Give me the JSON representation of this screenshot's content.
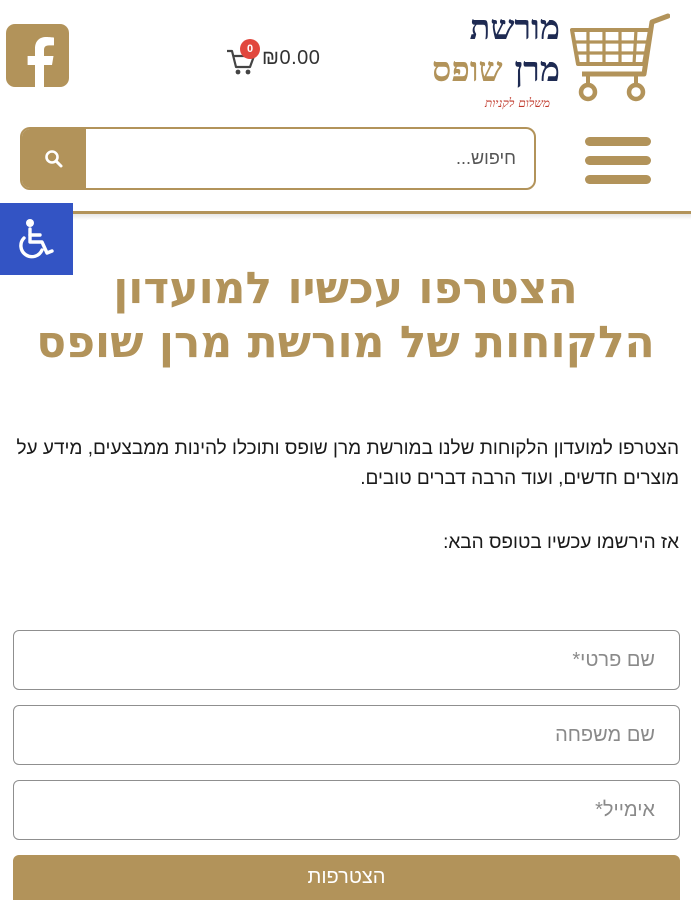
{
  "header": {
    "facebook_icon": "facebook-icon",
    "cart": {
      "count": "0",
      "amount": "₪0.00",
      "icon": "cart-icon"
    },
    "logo": {
      "line1": "מורשת",
      "line2_a": "מרן",
      "line2_b": "שופס",
      "tagline": "משלום לקניות"
    },
    "search": {
      "placeholder": "חיפוש...",
      "value": "",
      "icon": "search-icon"
    },
    "menu_icon": "hamburger-icon"
  },
  "accessibility": {
    "icon": "wheelchair-icon"
  },
  "main": {
    "headline_line1": "הצטרפו עכשיו למועדון",
    "headline_line2": "הלקוחות של מורשת מרן שופס",
    "intro": "הצטרפו למועדון הלקוחות שלנו במורשת מרן שופס ותוכלו להינות ממבצעים, מידע על מוצרים חדשים, ועוד הרבה דברים טובים.",
    "cta": "אז הירשמו עכשיו בטופס הבא:"
  },
  "form": {
    "first_name": {
      "placeholder": "שם פרטי*",
      "value": ""
    },
    "last_name": {
      "placeholder": "שם משפחה",
      "value": ""
    },
    "email": {
      "placeholder": "אימייל*",
      "value": ""
    },
    "submit_label": "הצטרפות"
  },
  "colors": {
    "gold": "#b2935a",
    "navy": "#1e2a52",
    "a11y_blue": "#3354c4",
    "badge_red": "#e1473d"
  }
}
